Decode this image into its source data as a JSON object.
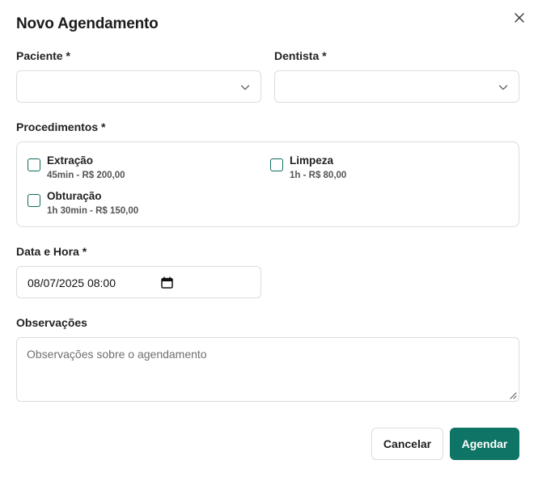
{
  "dialog": {
    "title": "Novo Agendamento",
    "close_icon": "close-icon"
  },
  "fields": {
    "paciente": {
      "label": "Paciente *",
      "value": ""
    },
    "dentista": {
      "label": "Dentista *",
      "value": ""
    },
    "procedimentos": {
      "label": "Procedimentos *",
      "items": [
        {
          "name": "Extração",
          "meta": "45min - R$ 200,00",
          "checked": false
        },
        {
          "name": "Limpeza",
          "meta": "1h - R$ 80,00",
          "checked": false
        },
        {
          "name": "Obturação",
          "meta": "1h 30min - R$ 150,00",
          "checked": false
        }
      ]
    },
    "data_hora": {
      "label": "Data e Hora *",
      "value": "08/07/2025 08:00",
      "icon": "calendar-icon"
    },
    "observacoes": {
      "label": "Observações",
      "placeholder": "Observações sobre o agendamento",
      "value": ""
    }
  },
  "actions": {
    "cancel_label": "Cancelar",
    "submit_label": "Agendar"
  },
  "colors": {
    "accent": "#0e7465",
    "border": "#dcdcdc",
    "text": "#1b1b1b"
  }
}
